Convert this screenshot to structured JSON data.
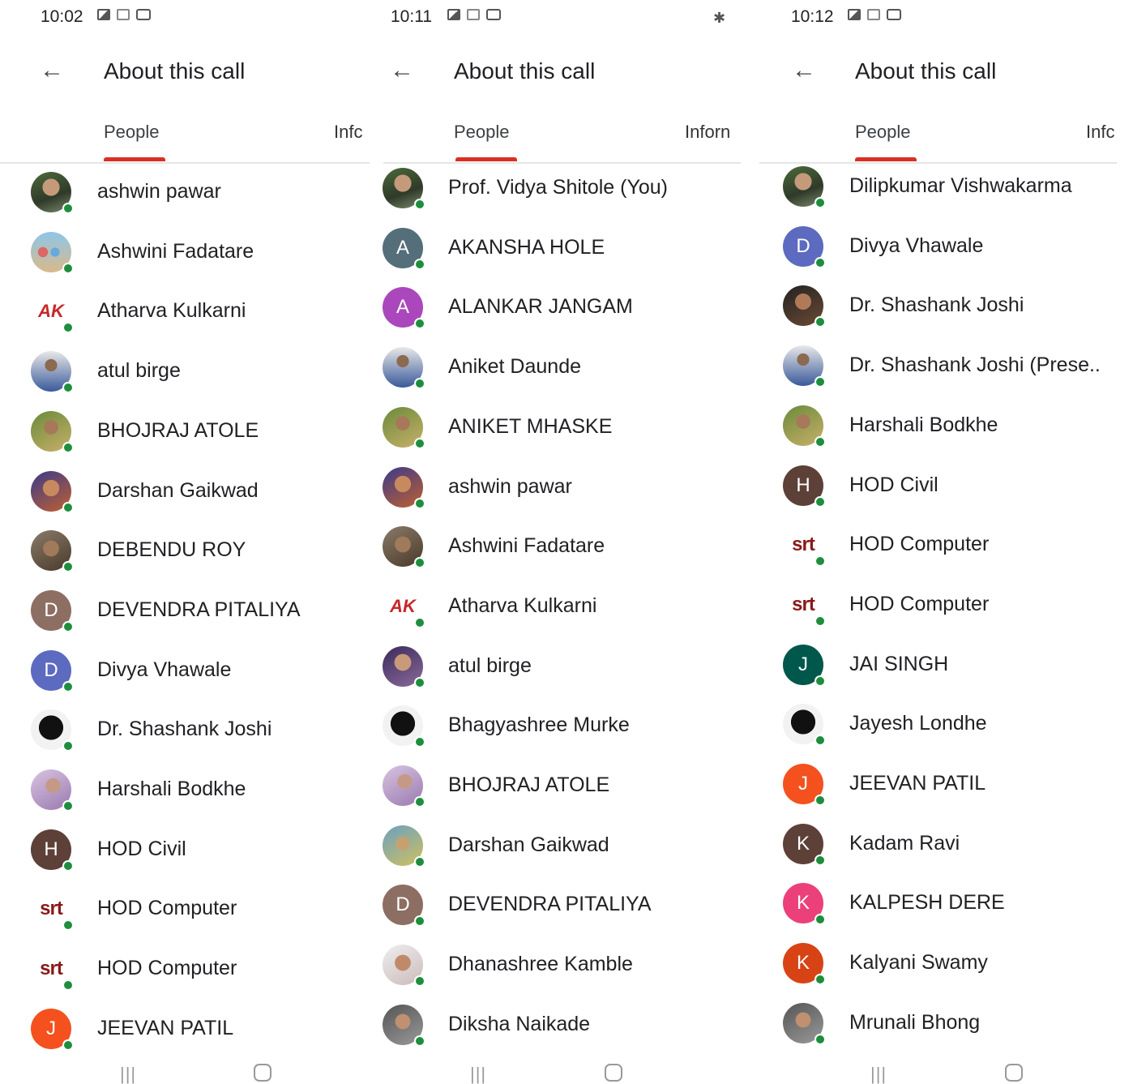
{
  "colors": {
    "accent": "#d93025",
    "online": "#1e8e3e"
  },
  "screens": [
    {
      "time": "10:02",
      "bluetooth": "",
      "title": "About this call",
      "tab_people": "People",
      "tab_info": "Infc",
      "people": [
        {
          "name": "ashwin pawar",
          "avatar": "photo"
        },
        {
          "name": "Ashwini Fadatare",
          "avatar": "photo"
        },
        {
          "name": "Atharva Kulkarni",
          "avatar": "logo"
        },
        {
          "name": "atul birge",
          "avatar": "photo"
        },
        {
          "name": "BHOJRAJ ATOLE",
          "avatar": "photo"
        },
        {
          "name": "Darshan Gaikwad",
          "avatar": "photo"
        },
        {
          "name": "DEBENDU ROY",
          "avatar": "photo"
        },
        {
          "name": "DEVENDRA PITALIYA",
          "avatar": "letter",
          "letter": "D",
          "color": "#8d6e63"
        },
        {
          "name": "Divya Vhawale",
          "avatar": "letter",
          "letter": "D",
          "color": "#5c6bc0"
        },
        {
          "name": "Dr. Shashank Joshi",
          "avatar": "photo"
        },
        {
          "name": "Harshali Bodkhe",
          "avatar": "photo"
        },
        {
          "name": "HOD Civil",
          "avatar": "letter",
          "letter": "H",
          "color": "#5d4037"
        },
        {
          "name": "HOD Computer",
          "avatar": "logo"
        },
        {
          "name": "HOD Computer",
          "avatar": "logo"
        },
        {
          "name": "JEEVAN PATIL",
          "avatar": "letter",
          "letter": "J",
          "color": "#f4511e"
        }
      ]
    },
    {
      "time": "10:11",
      "bluetooth": "✱",
      "title": "About this call",
      "tab_people": "People",
      "tab_info": "Inforn",
      "people": [
        {
          "name": "Prof. Vidya Shitole (You)",
          "avatar": "photo"
        },
        {
          "name": "AKANSHA HOLE",
          "avatar": "letter",
          "letter": "A",
          "color": "#546e7a"
        },
        {
          "name": "ALANKAR JANGAM",
          "avatar": "letter",
          "letter": "A",
          "color": "#ab47bc"
        },
        {
          "name": "Aniket Daunde",
          "avatar": "photo"
        },
        {
          "name": "ANIKET MHASKE",
          "avatar": "photo"
        },
        {
          "name": "ashwin pawar",
          "avatar": "photo"
        },
        {
          "name": "Ashwini Fadatare",
          "avatar": "photo"
        },
        {
          "name": "Atharva Kulkarni",
          "avatar": "logo"
        },
        {
          "name": "atul birge",
          "avatar": "photo"
        },
        {
          "name": "Bhagyashree Murke",
          "avatar": "photo"
        },
        {
          "name": "BHOJRAJ ATOLE",
          "avatar": "photo"
        },
        {
          "name": "Darshan Gaikwad",
          "avatar": "photo"
        },
        {
          "name": "DEVENDRA PITALIYA",
          "avatar": "letter",
          "letter": "D",
          "color": "#8d6e63"
        },
        {
          "name": "Dhanashree Kamble",
          "avatar": "photo"
        },
        {
          "name": "Diksha Naikade",
          "avatar": "photo"
        }
      ]
    },
    {
      "time": "10:12",
      "bluetooth": "",
      "title": "About this call",
      "tab_people": "People",
      "tab_info": "Infc",
      "people": [
        {
          "name": "Dilipkumar Vishwakarma",
          "avatar": "photo"
        },
        {
          "name": "Divya Vhawale",
          "avatar": "letter",
          "letter": "D",
          "color": "#5c6bc0"
        },
        {
          "name": "Dr. Shashank Joshi",
          "avatar": "photo"
        },
        {
          "name": "Dr. Shashank Joshi (Prese..",
          "avatar": "photo"
        },
        {
          "name": "Harshali Bodkhe",
          "avatar": "photo"
        },
        {
          "name": "HOD Civil",
          "avatar": "letter",
          "letter": "H",
          "color": "#5d4037"
        },
        {
          "name": "HOD Computer",
          "avatar": "logo"
        },
        {
          "name": "HOD Computer",
          "avatar": "logo"
        },
        {
          "name": "JAI SINGH",
          "avatar": "letter",
          "letter": "J",
          "color": "#00574b"
        },
        {
          "name": "Jayesh Londhe",
          "avatar": "photo"
        },
        {
          "name": "JEEVAN PATIL",
          "avatar": "letter",
          "letter": "J",
          "color": "#f4511e"
        },
        {
          "name": "Kadam Ravi",
          "avatar": "letter",
          "letter": "K",
          "color": "#5d4037"
        },
        {
          "name": "KALPESH DERE",
          "avatar": "letter",
          "letter": "K",
          "color": "#ec407a"
        },
        {
          "name": "Kalyani Swamy",
          "avatar": "letter",
          "letter": "K",
          "color": "#d84315"
        },
        {
          "name": "Mrunali Bhong",
          "avatar": "photo"
        }
      ]
    }
  ],
  "nav": {
    "recent_glyph": "|||"
  }
}
